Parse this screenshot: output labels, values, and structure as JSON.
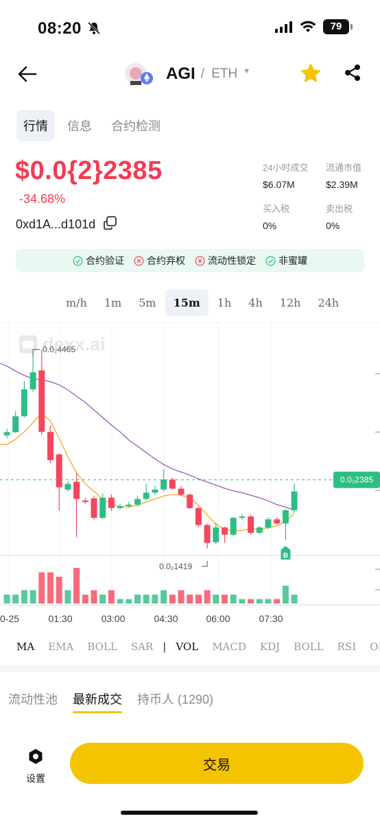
{
  "status": {
    "time": "08:20",
    "battery": "79"
  },
  "header": {
    "symbol": "AGI",
    "separator": "/",
    "chain": "ETH"
  },
  "tabs": [
    {
      "label": "行情",
      "active": true
    },
    {
      "label": "信息",
      "active": false
    },
    {
      "label": "合约检测",
      "active": false
    }
  ],
  "price": {
    "display": "$0.0{2}2385",
    "change": "-34.68%",
    "address": "0xd1A...d101d"
  },
  "stats": [
    {
      "label": "24小时成交",
      "value": "$6.07M"
    },
    {
      "label": "流通市值",
      "value": "$2.39M"
    },
    {
      "label": "买入税",
      "value": "0%"
    },
    {
      "label": "卖出税",
      "value": "0%"
    }
  ],
  "checks": [
    {
      "label": "合约验证",
      "status": "pass"
    },
    {
      "label": "合约弃权",
      "status": "fail"
    },
    {
      "label": "流动性锁定",
      "status": "fail"
    },
    {
      "label": "非蜜罐",
      "status": "pass"
    }
  ],
  "intervals": [
    "m/h",
    "1m",
    "5m",
    "15m",
    "1h",
    "4h",
    "12h",
    "24h"
  ],
  "active_interval": "15m",
  "colors": {
    "up": "#2ebd85",
    "down": "#f6465d",
    "accent": "#f5c400",
    "ma_fast": "#f5a623",
    "ma_slow": "#9b59b6"
  },
  "chart_data": {
    "type": "candlestick",
    "watermark": "dexx.ai",
    "current_price_label": "0.0₂2385",
    "high_label": "0.0₂4465",
    "low_label": "0.0₂1419",
    "buy_marker": "B",
    "x_tick_labels": [
      "0-25",
      "01:30",
      "03:00",
      "04:30",
      "06:00",
      "07:30"
    ],
    "candles": [
      {
        "o": 0.003095,
        "c": 0.003145,
        "h": 0.0032,
        "l": 0.00305,
        "v": 2
      },
      {
        "o": 0.003145,
        "c": 0.0034,
        "h": 0.00348,
        "l": 0.00313,
        "v": 2
      },
      {
        "o": 0.0034,
        "c": 0.003828,
        "h": 0.00396,
        "l": 0.00338,
        "v": 3
      },
      {
        "o": 0.003828,
        "c": 0.0041,
        "h": 0.00439,
        "l": 0.00379,
        "v": 3
      },
      {
        "o": 0.00413,
        "c": 0.00315,
        "h": 0.004465,
        "l": 0.0031,
        "v": 7
      },
      {
        "o": 0.00315,
        "c": 0.0027,
        "h": 0.00325,
        "l": 0.00265,
        "v": 7
      },
      {
        "o": 0.00279,
        "c": 0.002265,
        "h": 0.00281,
        "l": 0.001895,
        "v": 6
      },
      {
        "o": 0.00223,
        "c": 0.00232,
        "h": 0.00236,
        "l": 0.0022,
        "v": 3
      },
      {
        "o": 0.002355,
        "c": 0.00208,
        "h": 0.00249,
        "l": 0.00147,
        "v": 8
      },
      {
        "o": 0.002055,
        "c": 0.00203,
        "h": 0.0021,
        "l": 0.002,
        "v": 2
      },
      {
        "o": 0.00209,
        "c": 0.00178,
        "h": 0.00213,
        "l": 0.00175,
        "v": 3
      },
      {
        "o": 0.00178,
        "c": 0.0021,
        "h": 0.002165,
        "l": 0.00176,
        "v": 2
      },
      {
        "o": 0.0021,
        "c": 0.001935,
        "h": 0.00215,
        "l": 0.00189,
        "v": 3
      },
      {
        "o": 0.001935,
        "c": 0.001965,
        "h": 0.002,
        "l": 0.00191,
        "v": 1
      },
      {
        "o": 0.001965,
        "c": 0.00199,
        "h": 0.00203,
        "l": 0.00194,
        "v": 1
      },
      {
        "o": 0.00199,
        "c": 0.00208,
        "h": 0.00213,
        "l": 0.00196,
        "v": 2
      },
      {
        "o": 0.00208,
        "c": 0.00218,
        "h": 0.00232,
        "l": 0.00206,
        "v": 2
      },
      {
        "o": 0.00218,
        "c": 0.00223,
        "h": 0.00229,
        "l": 0.00214,
        "v": 2
      },
      {
        "o": 0.00223,
        "c": 0.00239,
        "h": 0.00255,
        "l": 0.0022,
        "v": 3
      },
      {
        "o": 0.00239,
        "c": 0.002245,
        "h": 0.00242,
        "l": 0.00222,
        "v": 2
      },
      {
        "o": 0.002245,
        "c": 0.00215,
        "h": 0.00229,
        "l": 0.00213,
        "v": 3
      },
      {
        "o": 0.00215,
        "c": 0.001935,
        "h": 0.002165,
        "l": 0.00192,
        "v": 2
      },
      {
        "o": 0.001935,
        "c": 0.001665,
        "h": 0.00196,
        "l": 0.00163,
        "v": 2
      },
      {
        "o": 0.001665,
        "c": 0.00138,
        "h": 0.001685,
        "l": 0.00129,
        "v": 3
      },
      {
        "o": 0.00139,
        "c": 0.001625,
        "h": 0.0017,
        "l": 0.00136,
        "v": 2
      },
      {
        "o": 0.001625,
        "c": 0.00151,
        "h": 0.00164,
        "l": 0.00138,
        "v": 2
      },
      {
        "o": 0.00151,
        "c": 0.00178,
        "h": 0.0018,
        "l": 0.00149,
        "v": 2
      },
      {
        "o": 0.00178,
        "c": 0.0018,
        "h": 0.00183,
        "l": 0.00175,
        "v": 1
      },
      {
        "o": 0.0018,
        "c": 0.00154,
        "h": 0.00183,
        "l": 0.00151,
        "v": 1
      },
      {
        "o": 0.00154,
        "c": 0.001625,
        "h": 0.00165,
        "l": 0.00152,
        "v": 1
      },
      {
        "o": 0.001625,
        "c": 0.001755,
        "h": 0.00179,
        "l": 0.0016,
        "v": 1
      },
      {
        "o": 0.001755,
        "c": 0.00169,
        "h": 0.00179,
        "l": 0.00167,
        "v": 1
      },
      {
        "o": 0.00169,
        "c": 0.0019,
        "h": 0.00192,
        "l": 0.00142,
        "v": 4
      },
      {
        "o": 0.0019,
        "c": 0.0022,
        "h": 0.00233,
        "l": 0.00186,
        "v": 2
      }
    ],
    "ma_fast": [
      0.00295,
      0.00303,
      0.00315,
      0.0033,
      0.00345,
      0.00332,
      0.00305,
      0.00275,
      0.0025,
      0.00232,
      0.0022,
      0.00208,
      0.002,
      0.00196,
      0.00195,
      0.00198,
      0.00203,
      0.00208,
      0.00213,
      0.00215,
      0.00214,
      0.0021,
      0.00198,
      0.00182,
      0.00168,
      0.00159,
      0.00157,
      0.00158,
      0.0016,
      0.0016,
      0.00162,
      0.00165,
      0.00172,
      0.00185
    ],
    "ma_slow": [
      0.0042,
      0.00412,
      0.00405,
      0.004,
      0.00398,
      0.00395,
      0.0039,
      0.00382,
      0.00372,
      0.00362,
      0.0035,
      0.00338,
      0.00326,
      0.00315,
      0.00302,
      0.00292,
      0.00282,
      0.00272,
      0.00263,
      0.00256,
      0.00251,
      0.00246,
      0.0024,
      0.00235,
      0.0023,
      0.00225,
      0.00221,
      0.00218,
      0.00214,
      0.0021,
      0.00205,
      0.00199,
      0.00195,
      0.0019
    ],
    "ylim": [
      0.0012,
      0.0047
    ]
  },
  "indicators": {
    "main": [
      {
        "label": "MA",
        "active": true
      },
      {
        "label": "EMA",
        "active": false
      },
      {
        "label": "BOLL",
        "active": false
      },
      {
        "label": "SAR",
        "active": false
      }
    ],
    "separator": "|",
    "sub": [
      {
        "label": "VOL",
        "active": true
      },
      {
        "label": "MACD",
        "active": false
      },
      {
        "label": "KDJ",
        "active": false
      },
      {
        "label": "BOLL",
        "active": false
      },
      {
        "label": "RSI",
        "active": false
      },
      {
        "label": "OBV",
        "active": false
      }
    ]
  },
  "bottom_tabs": [
    {
      "label": "流动性池",
      "active": false
    },
    {
      "label": "最新成交",
      "active": true
    },
    {
      "label": "持币人 (1290)",
      "active": false
    }
  ],
  "footer": {
    "settings_label": "设置",
    "trade_label": "交易"
  }
}
